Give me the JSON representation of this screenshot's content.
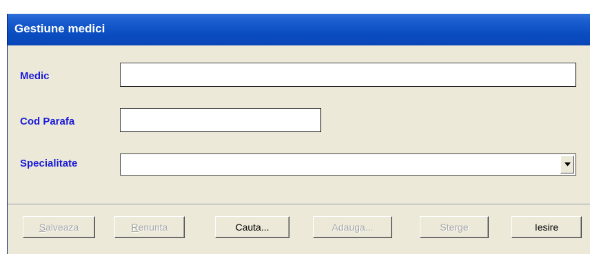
{
  "window": {
    "title": "Gestiune medici"
  },
  "form": {
    "medic": {
      "label": "Medic",
      "value": ""
    },
    "cod_parafa": {
      "label": "Cod Parafa",
      "value": ""
    },
    "specialitate": {
      "label": "Specialitate",
      "value": ""
    }
  },
  "buttons": [
    {
      "accel": "S",
      "rest": "alveaza",
      "enabled": false
    },
    {
      "accel": "R",
      "rest": "enunta",
      "enabled": false
    },
    {
      "accel": "",
      "rest": "Cauta...",
      "enabled": true
    },
    {
      "accel": "",
      "rest": "Adauga...",
      "enabled": false
    },
    {
      "accel": "",
      "rest": "Sterge",
      "enabled": false
    },
    {
      "accel": "",
      "rest": "Iesire",
      "enabled": true
    }
  ],
  "icons": {
    "dropdown": "chevron-down-icon"
  },
  "colors": {
    "titlebar": "#0a4ec2",
    "label": "#1b1bd8",
    "window_bg": "#ece9d8",
    "disabled_text": "#a7a6aa"
  }
}
